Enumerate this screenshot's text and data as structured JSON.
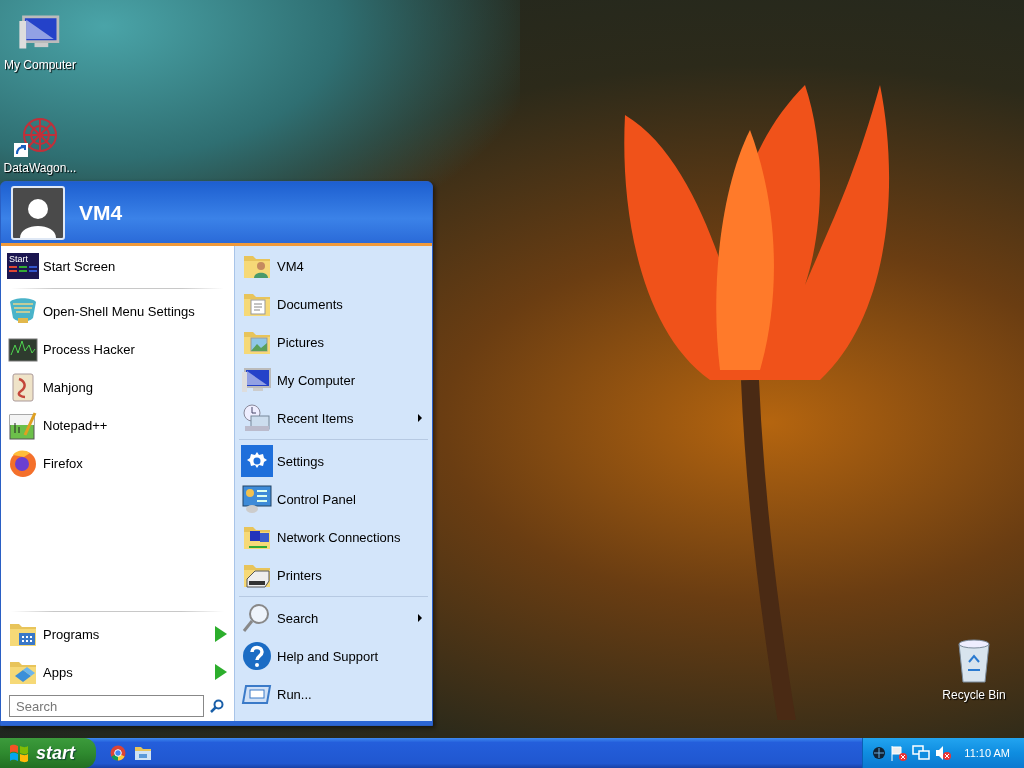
{
  "desktop_icons": [
    {
      "label": "My Computer",
      "shortcut": false
    },
    {
      "label": "DataWagon...",
      "shortcut": true
    }
  ],
  "recycle_bin": {
    "label": "Recycle Bin"
  },
  "start_menu": {
    "user": "VM4",
    "pinned": [
      {
        "label": "Start Screen",
        "tile_text": "Start"
      }
    ],
    "recent": [
      {
        "label": "Open-Shell Menu Settings"
      },
      {
        "label": "Process Hacker"
      },
      {
        "label": "Mahjong"
      },
      {
        "label": "Notepad++"
      },
      {
        "label": "Firefox"
      }
    ],
    "bottom": [
      {
        "label": "Programs",
        "submenu": true
      },
      {
        "label": "Apps",
        "submenu": true
      }
    ],
    "search": {
      "placeholder": "Search"
    },
    "places": [
      {
        "items": [
          {
            "label": "VM4",
            "submenu": false
          },
          {
            "label": "Documents",
            "submenu": false
          },
          {
            "label": "Pictures",
            "submenu": false
          },
          {
            "label": "My Computer",
            "submenu": false
          },
          {
            "label": "Recent Items",
            "submenu": true
          }
        ]
      },
      {
        "items": [
          {
            "label": "Settings",
            "submenu": false
          },
          {
            "label": "Control Panel",
            "submenu": false
          },
          {
            "label": "Network Connections",
            "submenu": false
          },
          {
            "label": "Printers",
            "submenu": false
          }
        ]
      },
      {
        "items": [
          {
            "label": "Search",
            "submenu": true
          },
          {
            "label": "Help and Support",
            "submenu": false
          },
          {
            "label": "Run...",
            "submenu": false
          }
        ]
      }
    ]
  },
  "taskbar": {
    "start_label": "start",
    "clock": "11:10 AM"
  }
}
